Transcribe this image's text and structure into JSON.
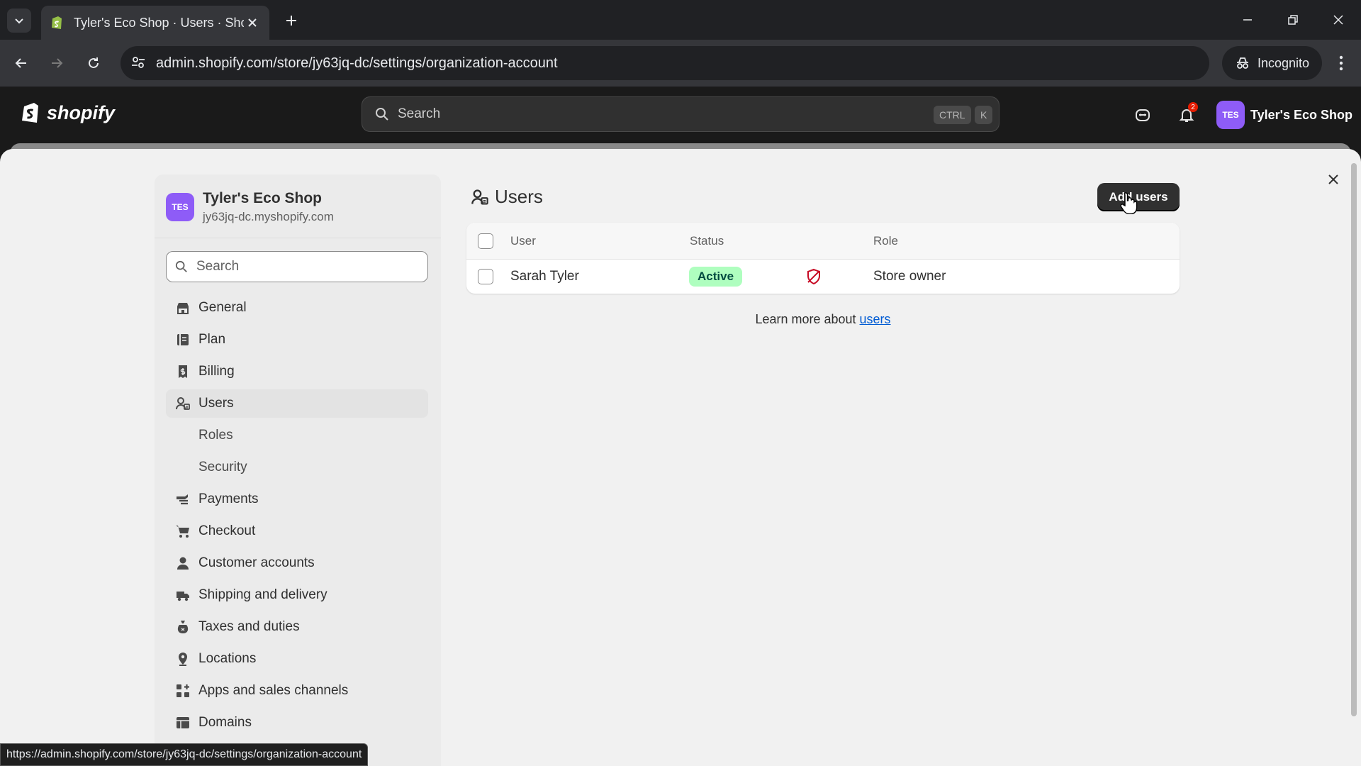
{
  "browser": {
    "tab_title": "Tyler's Eco Shop · Users · Shopif",
    "url": "admin.shopify.com/store/jy63jq-dc/settings/organization-account",
    "incognito_label": "Incognito",
    "status_url": "https://admin.shopify.com/store/jy63jq-dc/settings/organization-account"
  },
  "topbar": {
    "logo_text": "shopify",
    "search_placeholder": "Search",
    "shortcut_ctrl": "CTRL",
    "shortcut_k": "K",
    "notification_count": "2",
    "store_initials": "TES",
    "store_name": "Tyler's Eco Shop"
  },
  "settings_nav": {
    "shop_initials": "TES",
    "shop_name": "Tyler's Eco Shop",
    "shop_domain": "jy63jq-dc.myshopify.com",
    "search_placeholder": "Search",
    "items": [
      {
        "label": "General",
        "icon": "store-icon"
      },
      {
        "label": "Plan",
        "icon": "plan-icon"
      },
      {
        "label": "Billing",
        "icon": "receipt-icon"
      },
      {
        "label": "Users",
        "icon": "users-icon",
        "active": true
      },
      {
        "label": "Roles",
        "sub": true
      },
      {
        "label": "Security",
        "sub": true
      },
      {
        "label": "Payments",
        "icon": "payments-icon"
      },
      {
        "label": "Checkout",
        "icon": "cart-icon"
      },
      {
        "label": "Customer accounts",
        "icon": "person-icon"
      },
      {
        "label": "Shipping and delivery",
        "icon": "truck-icon"
      },
      {
        "label": "Taxes and duties",
        "icon": "tax-icon"
      },
      {
        "label": "Locations",
        "icon": "location-icon"
      },
      {
        "label": "Apps and sales channels",
        "icon": "apps-icon"
      },
      {
        "label": "Domains",
        "icon": "globe-icon"
      }
    ]
  },
  "main": {
    "title": "Users",
    "add_button": "Add users",
    "columns": {
      "user": "User",
      "status": "Status",
      "role": "Role"
    },
    "rows": [
      {
        "user": "Sarah Tyler",
        "status": "Active",
        "role": "Store owner"
      }
    ],
    "learn_prefix": "Learn more about ",
    "learn_link": "users"
  },
  "colors": {
    "accent_dark": "#303030",
    "active_badge_bg": "#affebf",
    "link": "#005bd3",
    "avatar": "#8e5cf7"
  }
}
